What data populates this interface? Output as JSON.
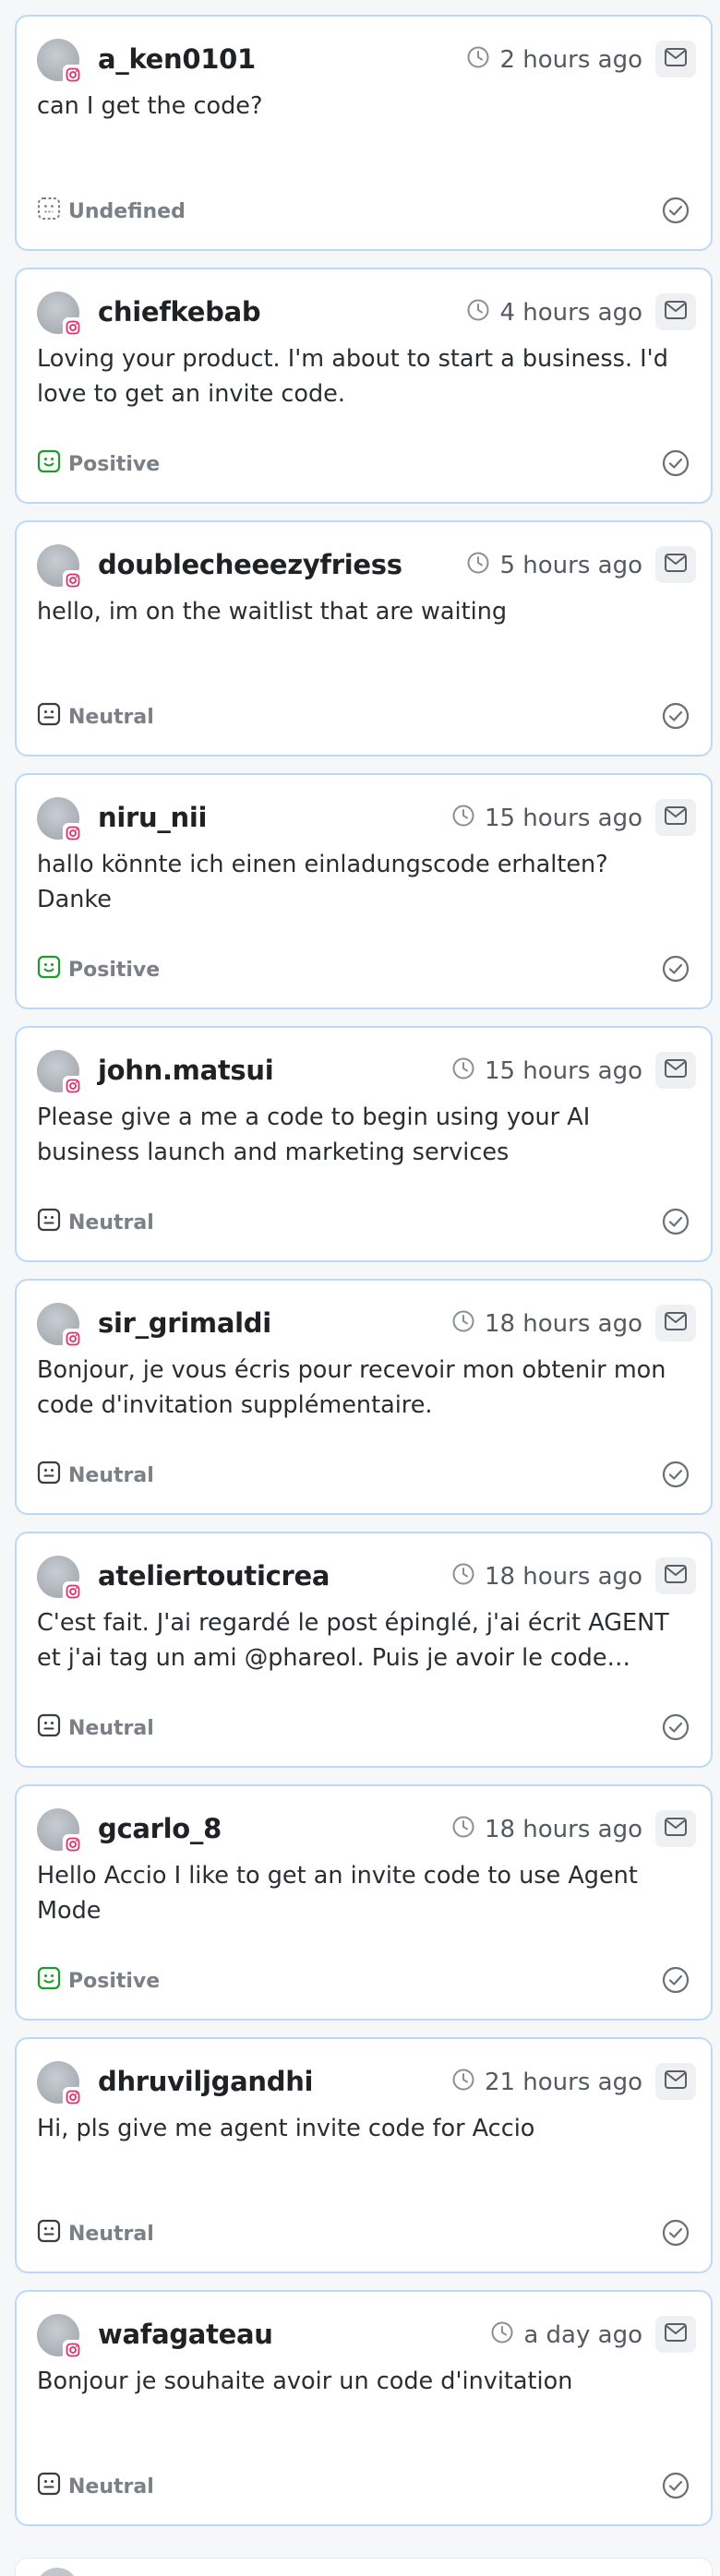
{
  "messages": [
    {
      "username": "a_ken0101",
      "time": "2 hours ago",
      "text": "can I get the code?",
      "sentiment": "Undefined",
      "sentiment_type": "undefined",
      "selected": true
    },
    {
      "username": "chiefkebab",
      "time": "4 hours ago",
      "text": "Loving your product. I'm about to start a business. I'd love to get an invite code.",
      "sentiment": "Positive",
      "sentiment_type": "positive",
      "selected": false
    },
    {
      "username": "doublecheeezyfriess",
      "time": "5 hours ago",
      "text": "hello, im on the waitlist that are waiting",
      "sentiment": "Neutral",
      "sentiment_type": "neutral",
      "selected": false
    },
    {
      "username": "niru_nii",
      "time": "15 hours ago",
      "text": "hallo könnte ich einen einladungscode erhalten? Danke",
      "sentiment": "Positive",
      "sentiment_type": "positive",
      "selected": false
    },
    {
      "username": "john.matsui",
      "time": "15 hours ago",
      "text": "Please give a me a code to begin using your AI business launch and marketing services",
      "sentiment": "Neutral",
      "sentiment_type": "neutral",
      "selected": false
    },
    {
      "username": "sir_grimaldi",
      "time": "18 hours ago",
      "text": "Bonjour, je vous écris pour recevoir mon obtenir mon code d'invitation supplémentaire.",
      "sentiment": "Neutral",
      "sentiment_type": "neutral",
      "selected": false
    },
    {
      "username": "ateliertouticrea",
      "time": "18 hours ago",
      "text": "C'est fait. J'ai regardé le post épinglé, j'ai écrit AGENT et j'ai tag un ami @phareol. Puis je avoir le code…",
      "sentiment": "Neutral",
      "sentiment_type": "neutral",
      "selected": false
    },
    {
      "username": "gcarlo_8",
      "time": "18 hours ago",
      "text": "Hello Accio I like to get an invite code to use Agent Mode",
      "sentiment": "Positive",
      "sentiment_type": "positive",
      "selected": false
    },
    {
      "username": "dhruviljgandhi",
      "time": "21 hours ago",
      "text": "Hi, pls give me agent invite code for Accio",
      "sentiment": "Neutral",
      "sentiment_type": "neutral",
      "selected": false
    },
    {
      "username": "wafagateau",
      "time": "a day ago",
      "text": "Bonjour je souhaite avoir un code d'invitation",
      "sentiment": "Neutral",
      "sentiment_type": "neutral",
      "selected": false
    }
  ],
  "icons": {
    "avatar": "avatar-placeholder",
    "platform": "instagram-icon",
    "time": "clock-icon",
    "reply": "mail-icon",
    "resolve": "check-circle-icon",
    "positive": "smile-face-icon",
    "neutral": "neutral-face-icon",
    "undefined": "dashed-face-icon"
  },
  "colors": {
    "positive": "#1f9a2c",
    "neutral": "#3a3d42",
    "undefined": "#7b8087",
    "selected_border": "#bcdaf7",
    "instagram": "#e1306c"
  }
}
